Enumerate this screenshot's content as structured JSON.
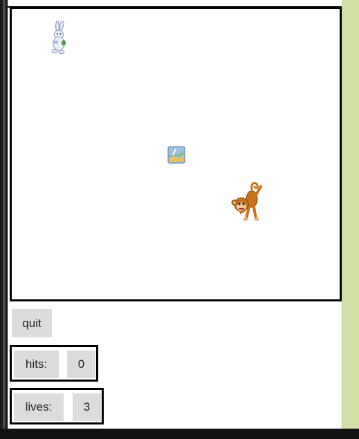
{
  "controls": {
    "quit_label": "quit"
  },
  "stats": {
    "hits_label": "hits:",
    "hits_value": "0",
    "lives_label": "lives:",
    "lives_value": "3"
  },
  "sprites": {
    "rabbit": "rabbit-icon",
    "monkey": "monkey-icon",
    "target": "target-tile-icon"
  },
  "colors": {
    "right_panel": "#d3e0a8",
    "button_bg": "#dcdcdc",
    "monkey_brown": "#c8741c"
  }
}
